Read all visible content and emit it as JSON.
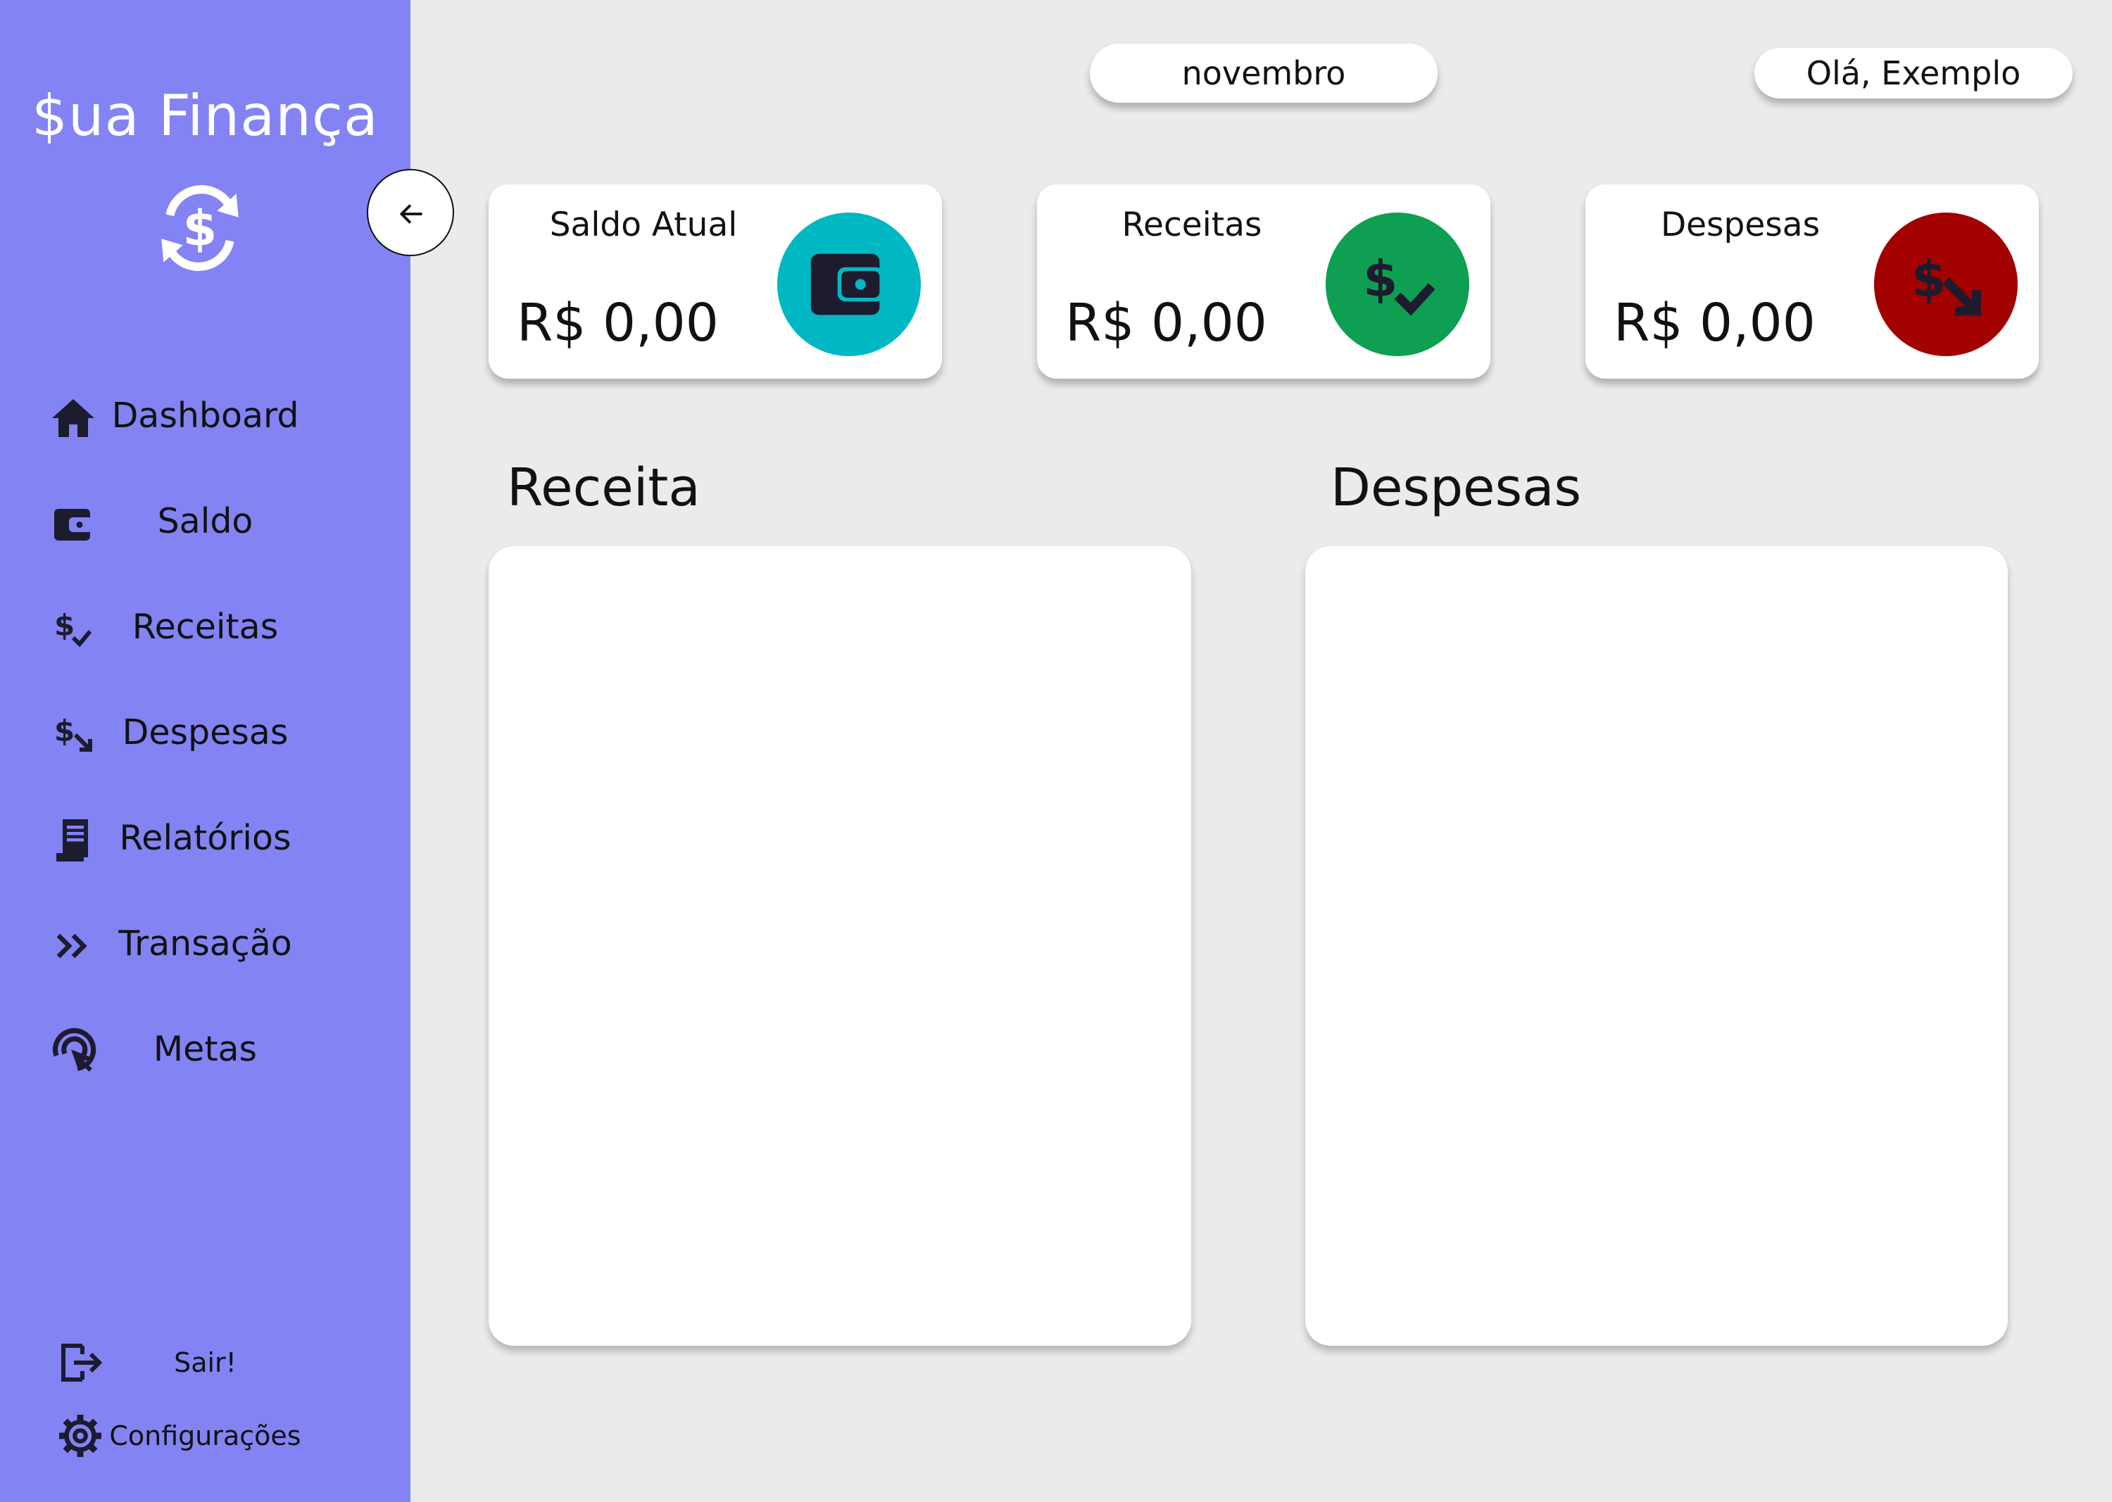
{
  "app": {
    "brand": "$ua Finança"
  },
  "sidebar": {
    "items": [
      {
        "label": "Dashboard",
        "icon": "home-icon"
      },
      {
        "label": "Saldo",
        "icon": "wallet-icon"
      },
      {
        "label": "Receitas",
        "icon": "dollar-check-icon"
      },
      {
        "label": "Despesas",
        "icon": "dollar-down-icon"
      },
      {
        "label": "Relatórios",
        "icon": "receipt-icon"
      },
      {
        "label": "Transação",
        "icon": "double-chevron-right-icon"
      },
      {
        "label": "Metas",
        "icon": "target-cursor-icon"
      }
    ],
    "footer": [
      {
        "label": "Sair!",
        "icon": "logout-icon"
      },
      {
        "label": "Configurações",
        "icon": "gear-icon"
      }
    ]
  },
  "header": {
    "month": "novembro",
    "greeting": "Olá, Exemplo"
  },
  "cards": [
    {
      "title": "Saldo Atual",
      "value": "R$ 0,00",
      "color": "#00b8c4",
      "icon": "wallet-icon"
    },
    {
      "title": "Receitas",
      "value": "R$ 0,00",
      "color": "#0e9f52",
      "icon": "dollar-check-icon"
    },
    {
      "title": "Despesas",
      "value": "R$ 0,00",
      "color": "#a30000",
      "icon": "dollar-down-icon"
    }
  ],
  "panels": [
    {
      "title": "Receita"
    },
    {
      "title": "Despesas"
    }
  ],
  "colors": {
    "sidebar": "#8383f4",
    "background": "#ebebeb"
  }
}
